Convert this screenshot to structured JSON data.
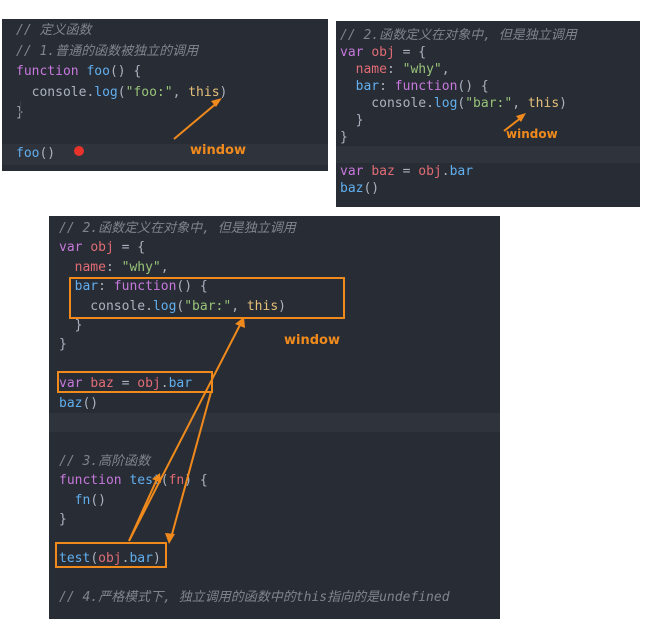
{
  "panel1": {
    "lines": [
      {
        "segs": [
          {
            "c": "cm",
            "t": "// 定义函数"
          }
        ]
      },
      {
        "segs": [
          {
            "c": "cm",
            "t": "// 1.普通的函数被独立的调用"
          }
        ]
      },
      {
        "segs": [
          {
            "c": "kw",
            "t": "function "
          },
          {
            "c": "fn",
            "t": "foo"
          },
          {
            "c": "plain",
            "t": "() {"
          }
        ]
      },
      {
        "segs": [
          {
            "c": "plain",
            "t": "  console."
          },
          {
            "c": "fn",
            "t": "log"
          },
          {
            "c": "plain",
            "t": "("
          },
          {
            "c": "str",
            "t": "\"foo:\""
          },
          {
            "c": "plain",
            "t": ", "
          },
          {
            "c": "this",
            "t": "this"
          },
          {
            "c": "plain",
            "t": ")"
          }
        ]
      },
      {
        "segs": [
          {
            "c": "plain",
            "t": "}"
          }
        ]
      },
      {
        "segs": [
          {
            "c": "plain",
            "t": ""
          }
        ]
      },
      {
        "segs": [
          {
            "c": "fn",
            "t": "foo"
          },
          {
            "c": "plain",
            "t": "()"
          }
        ]
      }
    ],
    "annotation": "window"
  },
  "panel2": {
    "lines": [
      {
        "segs": [
          {
            "c": "cm",
            "t": "// 2.函数定义在对象中, 但是独立调用"
          }
        ]
      },
      {
        "segs": [
          {
            "c": "kw",
            "t": "var "
          },
          {
            "c": "prop",
            "t": "obj"
          },
          {
            "c": "plain",
            "t": " = {"
          }
        ]
      },
      {
        "segs": [
          {
            "c": "plain",
            "t": "  "
          },
          {
            "c": "prop",
            "t": "name"
          },
          {
            "c": "plain",
            "t": ": "
          },
          {
            "c": "str",
            "t": "\"why\""
          },
          {
            "c": "plain",
            "t": ","
          }
        ]
      },
      {
        "segs": [
          {
            "c": "plain",
            "t": "  "
          },
          {
            "c": "fn",
            "t": "bar"
          },
          {
            "c": "plain",
            "t": ": "
          },
          {
            "c": "kw",
            "t": "function"
          },
          {
            "c": "plain",
            "t": "() {"
          }
        ]
      },
      {
        "segs": [
          {
            "c": "plain",
            "t": "    console."
          },
          {
            "c": "fn",
            "t": "log"
          },
          {
            "c": "plain",
            "t": "("
          },
          {
            "c": "str",
            "t": "\"bar:\""
          },
          {
            "c": "plain",
            "t": ", "
          },
          {
            "c": "this",
            "t": "this"
          },
          {
            "c": "plain",
            "t": ")"
          }
        ]
      },
      {
        "segs": [
          {
            "c": "plain",
            "t": "  }"
          }
        ]
      },
      {
        "segs": [
          {
            "c": "plain",
            "t": "}"
          }
        ]
      },
      {
        "segs": [
          {
            "c": "plain",
            "t": ""
          }
        ]
      },
      {
        "segs": [
          {
            "c": "kw",
            "t": "var "
          },
          {
            "c": "prop",
            "t": "baz"
          },
          {
            "c": "plain",
            "t": " = "
          },
          {
            "c": "prop",
            "t": "obj"
          },
          {
            "c": "plain",
            "t": "."
          },
          {
            "c": "fn",
            "t": "bar"
          }
        ]
      },
      {
        "segs": [
          {
            "c": "fn",
            "t": "baz"
          },
          {
            "c": "plain",
            "t": "()"
          }
        ]
      }
    ],
    "annotation": "window"
  },
  "panel3": {
    "lines": [
      {
        "segs": [
          {
            "c": "cm",
            "t": "// 2.函数定义在对象中, 但是独立调用"
          }
        ]
      },
      {
        "segs": [
          {
            "c": "kw",
            "t": "var "
          },
          {
            "c": "prop",
            "t": "obj"
          },
          {
            "c": "plain",
            "t": " = {"
          }
        ]
      },
      {
        "segs": [
          {
            "c": "plain",
            "t": "  "
          },
          {
            "c": "prop",
            "t": "name"
          },
          {
            "c": "plain",
            "t": ": "
          },
          {
            "c": "str",
            "t": "\"why\""
          },
          {
            "c": "plain",
            "t": ","
          }
        ]
      },
      {
        "segs": [
          {
            "c": "plain",
            "t": "  "
          },
          {
            "c": "fn",
            "t": "bar"
          },
          {
            "c": "plain",
            "t": ": "
          },
          {
            "c": "kw",
            "t": "function"
          },
          {
            "c": "plain",
            "t": "() {"
          }
        ]
      },
      {
        "segs": [
          {
            "c": "plain",
            "t": "    console."
          },
          {
            "c": "fn",
            "t": "log"
          },
          {
            "c": "plain",
            "t": "("
          },
          {
            "c": "str",
            "t": "\"bar:\""
          },
          {
            "c": "plain",
            "t": ", "
          },
          {
            "c": "this",
            "t": "this"
          },
          {
            "c": "plain",
            "t": ")"
          }
        ]
      },
      {
        "segs": [
          {
            "c": "plain",
            "t": "  }"
          }
        ]
      },
      {
        "segs": [
          {
            "c": "plain",
            "t": "}"
          }
        ]
      },
      {
        "segs": [
          {
            "c": "plain",
            "t": ""
          }
        ]
      },
      {
        "segs": [
          {
            "c": "kw",
            "t": "var "
          },
          {
            "c": "prop",
            "t": "baz"
          },
          {
            "c": "plain",
            "t": " = "
          },
          {
            "c": "prop",
            "t": "obj"
          },
          {
            "c": "plain",
            "t": "."
          },
          {
            "c": "fn",
            "t": "bar"
          }
        ]
      },
      {
        "segs": [
          {
            "c": "fn",
            "t": "baz"
          },
          {
            "c": "plain",
            "t": "()"
          }
        ]
      },
      {
        "segs": [
          {
            "c": "plain",
            "t": ""
          }
        ]
      },
      {
        "segs": [
          {
            "c": "plain",
            "t": ""
          }
        ]
      },
      {
        "segs": [
          {
            "c": "cm",
            "t": "// 3.高阶函数"
          }
        ]
      },
      {
        "segs": [
          {
            "c": "kw",
            "t": "function "
          },
          {
            "c": "fn",
            "t": "test"
          },
          {
            "c": "plain",
            "t": "("
          },
          {
            "c": "prop",
            "t": "fn"
          },
          {
            "c": "plain",
            "t": ") {"
          }
        ]
      },
      {
        "segs": [
          {
            "c": "plain",
            "t": "  "
          },
          {
            "c": "fn",
            "t": "fn"
          },
          {
            "c": "plain",
            "t": "()"
          }
        ]
      },
      {
        "segs": [
          {
            "c": "plain",
            "t": "}"
          }
        ]
      },
      {
        "segs": [
          {
            "c": "plain",
            "t": ""
          }
        ]
      },
      {
        "segs": [
          {
            "c": "fn",
            "t": "test"
          },
          {
            "c": "plain",
            "t": "("
          },
          {
            "c": "prop",
            "t": "obj"
          },
          {
            "c": "plain",
            "t": "."
          },
          {
            "c": "fn",
            "t": "bar"
          },
          {
            "c": "plain",
            "t": ")"
          }
        ]
      },
      {
        "segs": [
          {
            "c": "plain",
            "t": ""
          }
        ]
      },
      {
        "segs": [
          {
            "c": "cm",
            "t": "// 4.严格模式下, 独立调用的函数中的this指向的是undefined"
          }
        ]
      }
    ],
    "annotation": "window"
  },
  "colors": {
    "accent": "#f08a1c",
    "editor_bg": "#282c34"
  }
}
